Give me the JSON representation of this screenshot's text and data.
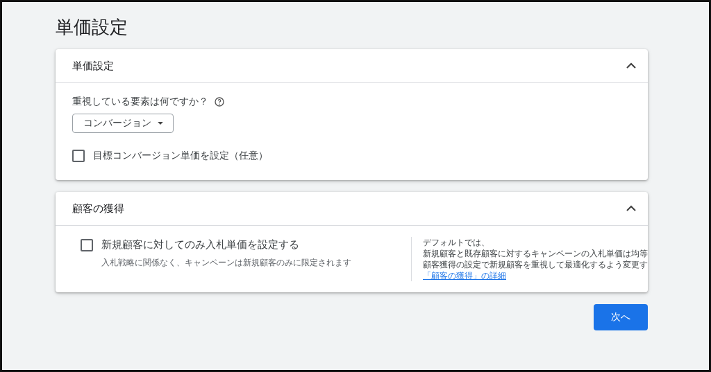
{
  "page_title": "単価設定",
  "sections": [
    {
      "title": "単価設定",
      "expanded": true,
      "kind": "bidding",
      "question": "重視している要素は何ですか？",
      "dropdown": {
        "value": "コンバージョン"
      },
      "checkbox": {
        "label": "目標コンバージョン単価を設定（任意）",
        "checked": false
      }
    },
    {
      "title": "顧客の獲得",
      "expanded": true,
      "kind": "acquisition",
      "checkbox": {
        "label": "新規顧客に対してのみ入札単価を設定する",
        "checked": false
      },
      "description": "入札戦略に関係なく、キャンペーンは新規顧客のみに限定されます",
      "info_lines": [
        "デフォルトでは、",
        "新規顧客と既存顧客に対するキャンペーンの入札単価は均等",
        "顧客獲得の設定で新規顧客を重視して最適化するよう変更す"
      ],
      "link": "「顧客の獲得」の詳細"
    }
  ],
  "next_button": "次へ"
}
